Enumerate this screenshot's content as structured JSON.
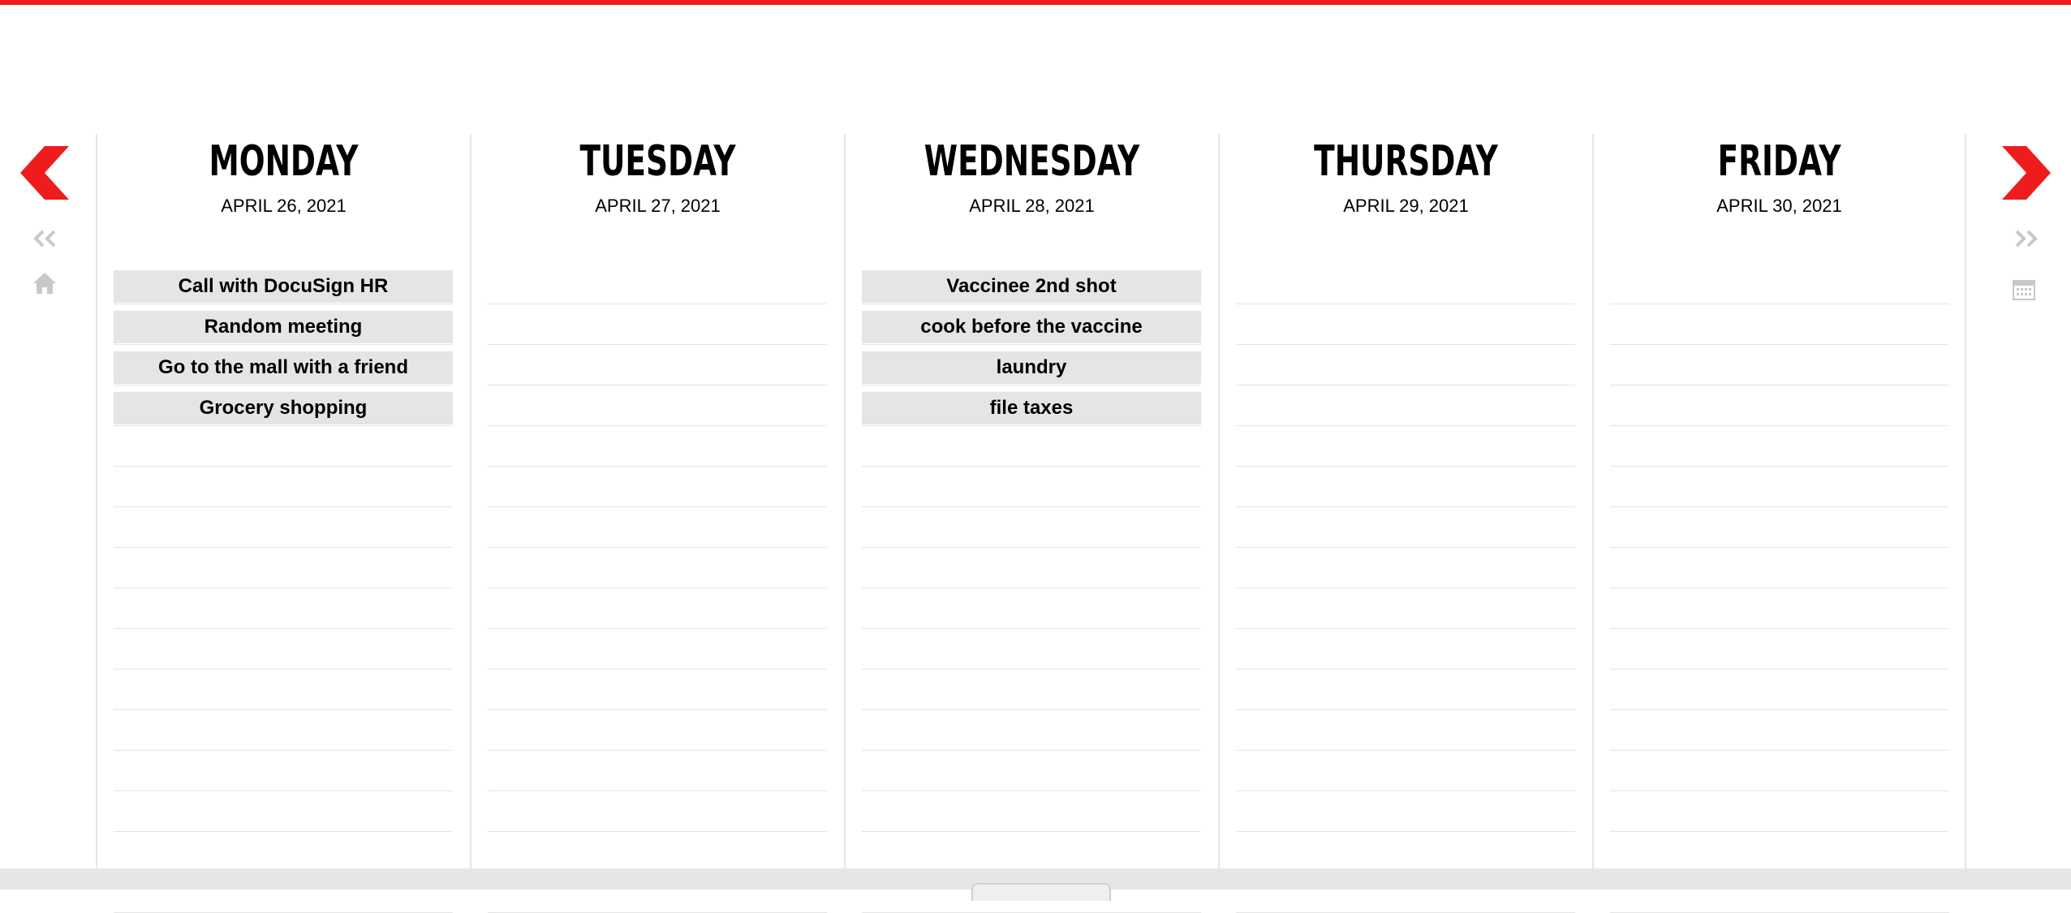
{
  "colors": {
    "accent": "#ee1c1c",
    "task_bg": "#e5e5e5",
    "nav_grey": "#c8c8c8"
  },
  "icons": {
    "prev_week": "chevron-left-icon",
    "next_week": "chevron-right-icon",
    "prev_far": "double-chevron-left-icon",
    "next_far": "double-chevron-right-icon",
    "home": "home-icon",
    "calendar": "calendar-icon"
  },
  "days": [
    {
      "name": "MONDAY",
      "date": "APRIL 26, 2021",
      "tasks": [
        "Call with DocuSign HR",
        "Random meeting",
        "Go to the mall with a friend",
        "Grocery shopping"
      ]
    },
    {
      "name": "TUESDAY",
      "date": "APRIL 27, 2021",
      "tasks": []
    },
    {
      "name": "WEDNESDAY",
      "date": "APRIL 28, 2021",
      "tasks": [
        "Vaccinee 2nd shot",
        "cook before the vaccine",
        "laundry",
        "file taxes"
      ]
    },
    {
      "name": "THURSDAY",
      "date": "APRIL 29, 2021",
      "tasks": []
    },
    {
      "name": "FRIDAY",
      "date": "APRIL 30, 2021",
      "tasks": []
    }
  ]
}
